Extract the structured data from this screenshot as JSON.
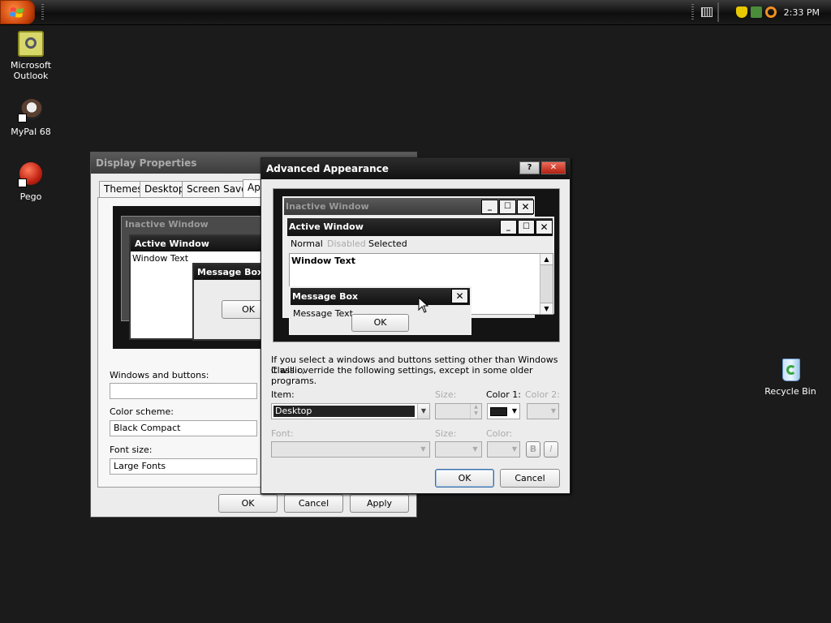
{
  "taskbar": {
    "clock": "2:33 PM"
  },
  "desktop_icons": [
    {
      "label_line1": "Microsoft",
      "label_line2": "Outlook",
      "icon": "outlook-icon"
    },
    {
      "label_line1": "MyPal 68",
      "label_line2": "",
      "icon": "mypal-icon"
    },
    {
      "label_line1": "Pego",
      "label_line2": "",
      "icon": "pego-icon"
    },
    {
      "label_line1": "Recycle Bin",
      "label_line2": "",
      "icon": "recycle-bin-icon"
    }
  ],
  "display_properties": {
    "title": "Display Properties",
    "tabs": [
      "Themes",
      "Desktop",
      "Screen Saver",
      "Ap"
    ],
    "preview": {
      "inactive": "Inactive Window",
      "active": "Active Window",
      "window_text": "Window Text",
      "message_box": "Message Box",
      "ok": "OK"
    },
    "windows_buttons_label": "Windows and buttons:",
    "windows_buttons_value": "",
    "color_scheme_label": "Color scheme:",
    "color_scheme_value": "Black Compact",
    "font_size_label": "Font size:",
    "font_size_value": "Large Fonts",
    "ok": "OK",
    "cancel": "Cancel",
    "apply": "Apply"
  },
  "advanced": {
    "title": "Advanced Appearance",
    "help_btn": "?",
    "close_btn": "✕",
    "preview": {
      "inactive": "Inactive Window",
      "active": "Active Window",
      "menu_normal": "Normal",
      "menu_disabled": "Disabled",
      "menu_selected": "Selected",
      "window_text": "Window Text",
      "message_box": "Message Box",
      "message_text": "Message Text",
      "ok": "OK"
    },
    "info_line1": "If you select a windows and buttons setting other than Windows Classic,",
    "info_line2": "it will override the following settings, except in some older programs.",
    "item_label": "Item:",
    "item_value": "Desktop",
    "size_label": "Size:",
    "color1_label": "Color 1:",
    "color2_label": "Color 2:",
    "font_label": "Font:",
    "font_size_label": "Size:",
    "font_color_label": "Color:",
    "bold_btn": "B",
    "italic_btn": "I",
    "ok": "OK",
    "cancel": "Cancel"
  },
  "colors": {
    "desktop": "#1b1b1b",
    "color1_swatch": "#1e1e1e"
  }
}
